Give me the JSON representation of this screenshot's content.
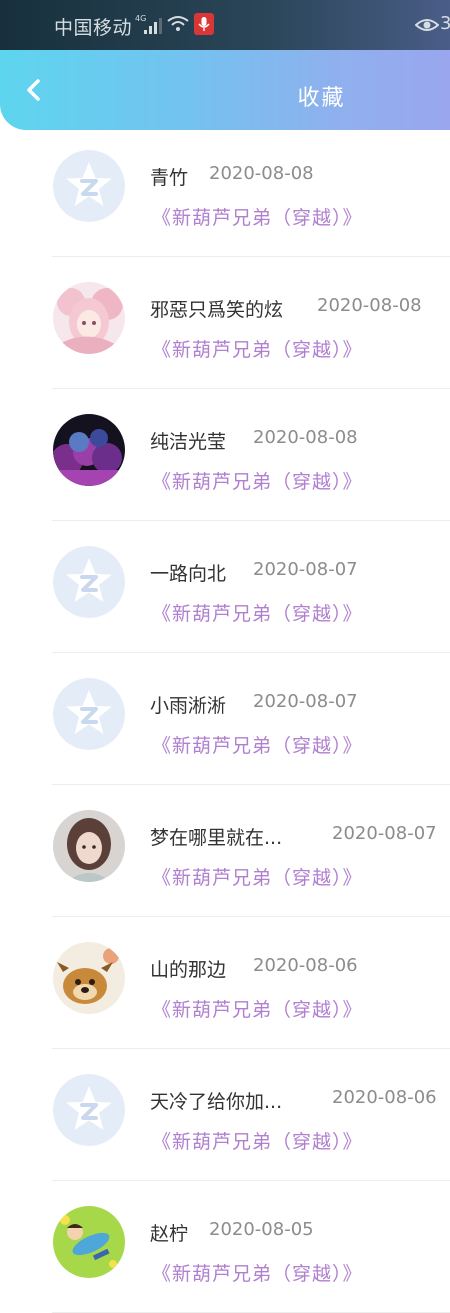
{
  "status_bar": {
    "carrier": "中国移动",
    "network": "4G",
    "battery": "3"
  },
  "header": {
    "title": "收藏"
  },
  "favorites": [
    {
      "name": "青竹",
      "date": "2020-08-08",
      "title": "《新葫芦兄弟（穿越）》",
      "avatar": "default-avatar"
    },
    {
      "name": "邪惡只爲笑的炫",
      "date": "2020-08-08",
      "title": "《新葫芦兄弟（穿越）》",
      "avatar": "pink-anime-girl-avatar"
    },
    {
      "name": "纯洁光莹",
      "date": "2020-08-08",
      "title": "《新葫芦兄弟（穿越）》",
      "avatar": "purple-cloud-avatar"
    },
    {
      "name": "一路向北",
      "date": "2020-08-07",
      "title": "《新葫芦兄弟（穿越）》",
      "avatar": "default-avatar"
    },
    {
      "name": "小雨淅淅",
      "date": "2020-08-07",
      "title": "《新葫芦兄弟（穿越）》",
      "avatar": "default-avatar"
    },
    {
      "name": "梦在哪里就在...",
      "date": "2020-08-07",
      "title": "《新葫芦兄弟（穿越）》",
      "avatar": "girl-portrait-avatar"
    },
    {
      "name": "山的那边",
      "date": "2020-08-06",
      "title": "《新葫芦兄弟（穿越）》",
      "avatar": "cartoon-dog-avatar"
    },
    {
      "name": "天冷了给你加...",
      "date": "2020-08-06",
      "title": "《新葫芦兄弟（穿越）》",
      "avatar": "default-avatar"
    },
    {
      "name": "赵柠",
      "date": "2020-08-05",
      "title": "《新葫芦兄弟（穿越）》",
      "avatar": "cartoon-boy-grass-avatar"
    }
  ]
}
